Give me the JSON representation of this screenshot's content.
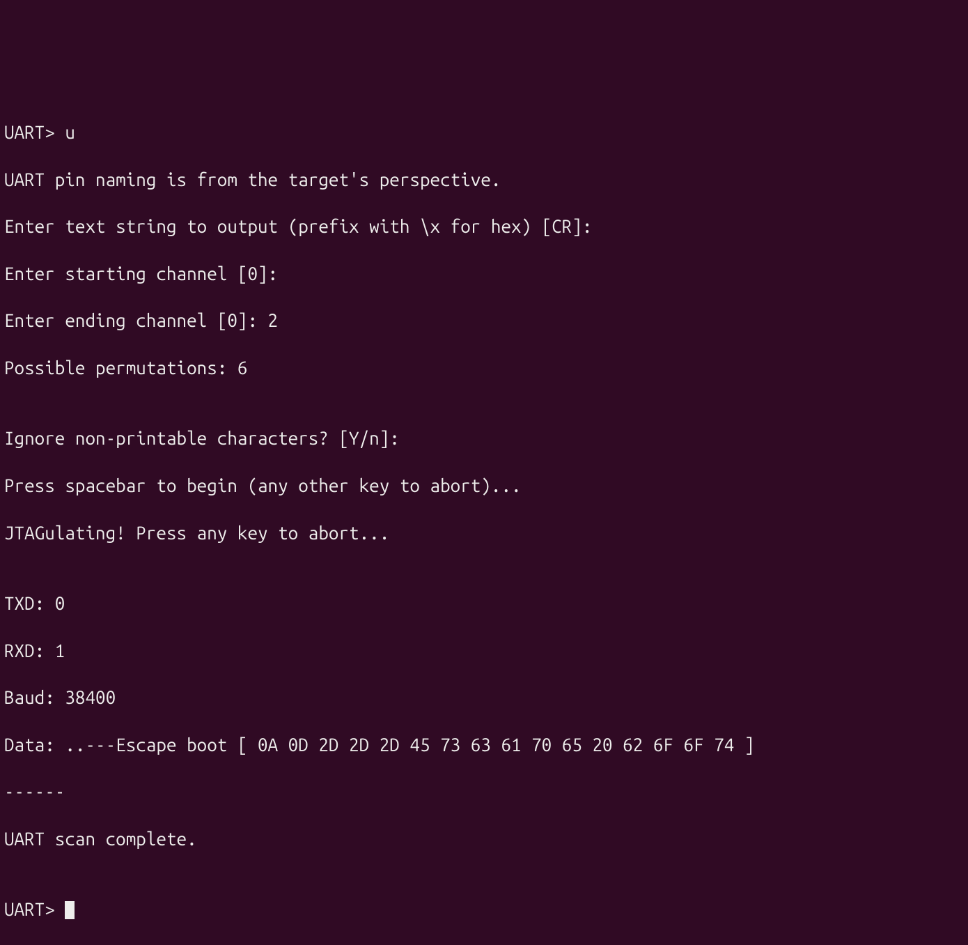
{
  "terminal": {
    "lines": [
      "UART> u",
      "UART pin naming is from the target's perspective.",
      "Enter text string to output (prefix with \\x for hex) [CR]:",
      "Enter starting channel [0]:",
      "Enter ending channel [0]: 2",
      "Possible permutations: 6",
      "",
      "Ignore non-printable characters? [Y/n]:",
      "Press spacebar to begin (any other key to abort)...",
      "JTAGulating! Press any key to abort...",
      "",
      "TXD: 0",
      "RXD: 1",
      "Baud: 38400",
      "Data: ..---Escape boot [ 0A 0D 2D 2D 2D 45 73 63 61 70 65 20 62 6F 6F 74 ]",
      "------",
      "UART scan complete.",
      "",
      "UART> "
    ],
    "colors": {
      "background": "#300a24",
      "foreground": "#eeeeec"
    }
  }
}
